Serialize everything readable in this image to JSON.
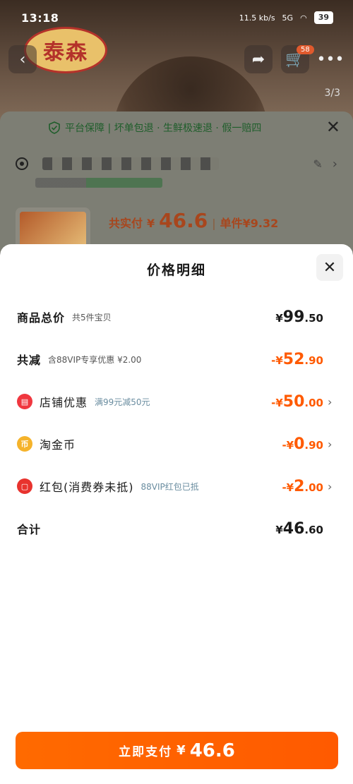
{
  "status": {
    "time": "13:18",
    "net_speed": "11.5 kb/s",
    "network": "5G",
    "battery": "39"
  },
  "background": {
    "brand_logo_text": "泰森",
    "page_indicator": "3/3",
    "cart_badge": "58",
    "guarantee_text": "平台保障 | 坏单包退 · 生鲜极速退 · 假一赔四",
    "paytotal_label": "共实付",
    "paytotal_yen": "¥",
    "paytotal_value": "46.6",
    "paytotal_sep": "|",
    "unit_price": "单件¥9.32"
  },
  "sheet": {
    "title": "价格明细",
    "rows": [
      {
        "label": "商品总价",
        "sub": "共5件宝贝",
        "yen": "¥",
        "int": "99",
        "dec": ".50",
        "color": "#1a1a1a"
      },
      {
        "label": "共减",
        "sub": "含88VIP专享优惠 ¥2.00",
        "yen": "-¥",
        "int": "52",
        "dec": ".90",
        "color": "#ff5a00"
      },
      {
        "label": "店铺优惠",
        "sub": "满99元减50元",
        "yen": "-¥",
        "int": "50",
        "dec": ".00",
        "icon": "shop-icon",
        "color": "#ff5a00"
      },
      {
        "label": "淘金币",
        "sub": "",
        "yen": "-¥",
        "int": "0",
        "dec": ".90",
        "icon": "coin-icon",
        "color": "#ff5a00"
      },
      {
        "label": "红包(消费券未抵)",
        "sub": "88VIP红包已抵",
        "yen": "-¥",
        "int": "2",
        "dec": ".00",
        "icon": "red-packet-icon",
        "color": "#ff5a00"
      },
      {
        "label": "合计",
        "sub": "",
        "yen": "¥",
        "int": "46",
        "dec": ".60",
        "color": "#1a1a1a"
      }
    ]
  },
  "pay_button": {
    "label": "立即支付",
    "yen": "¥",
    "value": "46.6"
  },
  "colors": {
    "accent": "#ff5a00",
    "guarantee_green": "#1f5e2b"
  }
}
